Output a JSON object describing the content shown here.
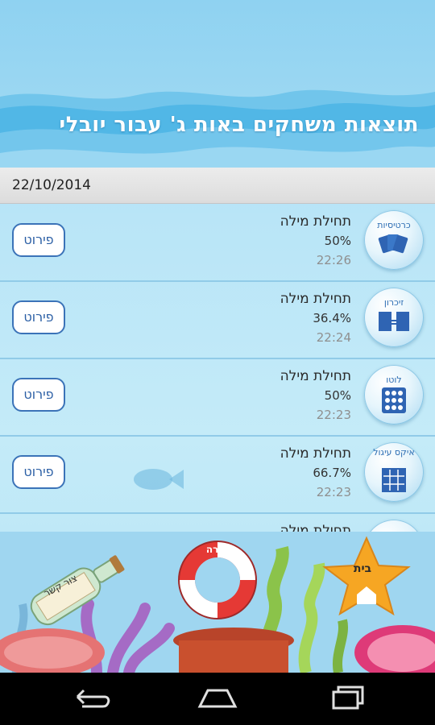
{
  "header": {
    "title": "תוצאות משחקים באות ג' עבור יובלי"
  },
  "date_bar": {
    "date": "22/10/2014"
  },
  "rows": [
    {
      "game": "תחילת מילה",
      "percent": "50%",
      "time": "22:26",
      "button": "פירוט",
      "icon": "cards-icon",
      "icon_label": "כרטיסיות"
    },
    {
      "game": "תחילת מילה",
      "percent": "36.4%",
      "time": "22:24",
      "button": "פירוט",
      "icon": "memory-icon",
      "icon_label": "זיכרון"
    },
    {
      "game": "תחילת מילה",
      "percent": "50%",
      "time": "22:23",
      "button": "פירוט",
      "icon": "lotto-icon",
      "icon_label": "לוטו"
    },
    {
      "game": "תחילת מילה",
      "percent": "66.7%",
      "time": "22:23",
      "button": "פירוט",
      "icon": "tic-tac-toe-icon",
      "icon_label": "איקס עיגול"
    },
    {
      "game": "תחילת מילה",
      "percent": "",
      "time": "",
      "button": "",
      "icon": "partial-bubble-icon",
      "icon_label": ""
    }
  ],
  "bottom": {
    "help_label": "עזרה",
    "home_label": "בית",
    "contact_label": "צור קשר"
  },
  "colors": {
    "accent": "#3b73b8",
    "sky": "#8fd2f1",
    "row_divider": "#8cc8e6"
  }
}
